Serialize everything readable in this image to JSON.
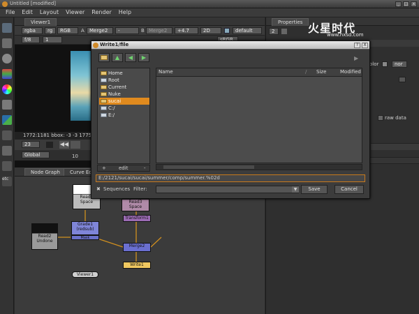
{
  "window": {
    "title": "Untitled [modified]"
  },
  "menu": [
    "File",
    "Edit",
    "Layout",
    "Viewer",
    "Render",
    "Help"
  ],
  "viewer": {
    "tab": "Viewer1",
    "channels": "rgba",
    "layer": "rg",
    "colorspace": "RGB",
    "input_a": "A",
    "merge": "Merge2",
    "dash": "-",
    "input_b": "B",
    "merge_b": "Merge2",
    "gain": "+4.7",
    "view": "2D",
    "lut": "default",
    "fstop": "f/8",
    "frame_field": "1",
    "srgb": "sRGB",
    "info": "1772:1181 bbox: -3 -3 1775",
    "frame": "23",
    "tick": "10",
    "proxy": "Global"
  },
  "nodegraph": {
    "tabs": [
      "Node Graph",
      "Curve Ed"
    ],
    "nodes": {
      "read1": "Read1",
      "read1_file": "Space",
      "read2": "Read2",
      "read2_file": "Undone",
      "read3": "Read3",
      "read3_file": "Space",
      "grade1": "Grade1",
      "grade1_sub": "(redsub)",
      "mask": "Mask",
      "transform1": "Transform1",
      "merge2": "Merge2",
      "merge_sub": "(over)",
      "write1": "Write1",
      "viewer1": "Viewer1"
    }
  },
  "properties": {
    "tab": "Properties",
    "count": "2",
    "label_olor": "olor",
    "none": "nor",
    "raw": "raw data",
    "watermark": "火星时代",
    "watermark_url": "www.hxsd.com"
  },
  "dialog": {
    "title": "Write1/file",
    "places": [
      "Home",
      "Root",
      "Current",
      "Nuke",
      "sucai",
      "C:/",
      "E:/"
    ],
    "selected_place": "sucai",
    "columns": {
      "name": "Name",
      "size": "Size",
      "modified": "Modified"
    },
    "add_label": "+",
    "edit_label": "edit",
    "minus_label": "-",
    "path": "E:/2121/sucai/sucai/summer/comp/summer.%02d",
    "sequences_label": "Sequences",
    "filter_label": "Filter:",
    "save": "Save",
    "cancel": "Cancel",
    "help": "?",
    "close": "X"
  },
  "colors": {
    "accent": "#e08a1e",
    "edge": "#d08f1f"
  }
}
